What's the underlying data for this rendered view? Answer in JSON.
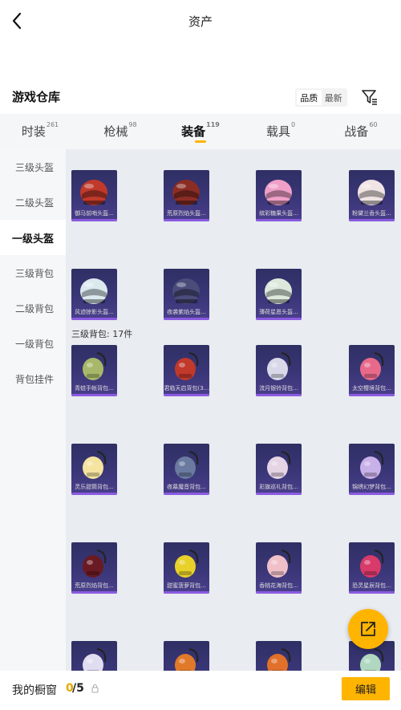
{
  "header": {
    "title": "资产"
  },
  "section": {
    "title": "游戏仓库"
  },
  "sort": {
    "options": [
      "品质",
      "最新"
    ],
    "active_index": 0
  },
  "tabs": [
    {
      "label": "时装",
      "count": "261"
    },
    {
      "label": "枪械",
      "count": "98"
    },
    {
      "label": "装备",
      "count": "119"
    },
    {
      "label": "载具",
      "count": "0"
    },
    {
      "label": "战备",
      "count": "60"
    }
  ],
  "active_tab_index": 2,
  "sidebar": {
    "items": [
      "三级头盔",
      "二级头盔",
      "一级头盔",
      "三级背包",
      "二级背包",
      "一级背包",
      "背包挂件"
    ],
    "active_index": 2
  },
  "helmets": [
    {
      "name": "御马前哨头盔...",
      "icon": "helmet-icon",
      "color": "#c0392b"
    },
    {
      "name": "荒原烈焰头盔...",
      "icon": "helmet-icon",
      "color": "#8b2d25"
    },
    {
      "name": "缤彩糖果头盔...",
      "icon": "helmet-icon",
      "color": "#f0a0c8"
    },
    {
      "name": "粉黛兰香头盔...",
      "icon": "helmet-icon",
      "color": "#f1e4e4"
    },
    {
      "name": "风迹掠影头盔...",
      "icon": "helmet-icon",
      "color": "#dbe9ef"
    },
    {
      "name": "夜袭紫焰头盔...",
      "icon": "helmet-icon",
      "color": "#4b4c7a"
    },
    {
      "name": "薄荷星愿头盔...",
      "icon": "helmet-icon",
      "color": "#dde8dc"
    }
  ],
  "backpack_group": {
    "label": "三级背包: 17件"
  },
  "backpacks": [
    {
      "name": "青蛙手帐背包...",
      "icon": "backpack-icon",
      "color": "#a8b86a"
    },
    {
      "name": "君临天启背包(3...",
      "icon": "backpack-icon",
      "color": "#c0392b"
    },
    {
      "name": "流月银铃背包...",
      "icon": "backpack-icon",
      "color": "#d8d8e8"
    },
    {
      "name": "太空樱境背包...",
      "icon": "backpack-icon",
      "color": "#e86a8a"
    },
    {
      "name": "灵乐甜筒背包...",
      "icon": "backpack-icon",
      "color": "#f5e3a0"
    },
    {
      "name": "夜幕魔音背包...",
      "icon": "backpack-icon",
      "color": "#6a7aa0"
    },
    {
      "name": "彩旗巡礼背包...",
      "icon": "backpack-icon",
      "color": "#e4d4e4"
    },
    {
      "name": "锦绣幻梦背包...",
      "icon": "backpack-icon",
      "color": "#c8b0e8"
    },
    {
      "name": "荒原烈焰背包...",
      "icon": "backpack-icon",
      "color": "#6a1a22"
    },
    {
      "name": "甜蜜菠萝背包...",
      "icon": "backpack-icon",
      "color": "#e8d22a"
    },
    {
      "name": "香桃花海背包...",
      "icon": "backpack-icon",
      "color": "#f0c0c8"
    },
    {
      "name": "恐灵星辰背包...",
      "icon": "backpack-icon",
      "color": "#d83a6a"
    },
    {
      "name": "",
      "icon": "backpack-icon",
      "color": "#e0ddf0"
    },
    {
      "name": "",
      "icon": "backpack-icon",
      "color": "#e07a2a"
    },
    {
      "name": "",
      "icon": "backpack-icon",
      "color": "#e0702a"
    },
    {
      "name": "",
      "icon": "backpack-icon",
      "color": "#b0d8c0"
    }
  ],
  "bottom": {
    "window_label": "我的橱窗",
    "used": "0",
    "total": "/5",
    "edit_label": "编辑"
  },
  "colors": {
    "accent": "#ffb400",
    "card_bg": "#3a3677",
    "card_bar": "#8a5be0"
  }
}
